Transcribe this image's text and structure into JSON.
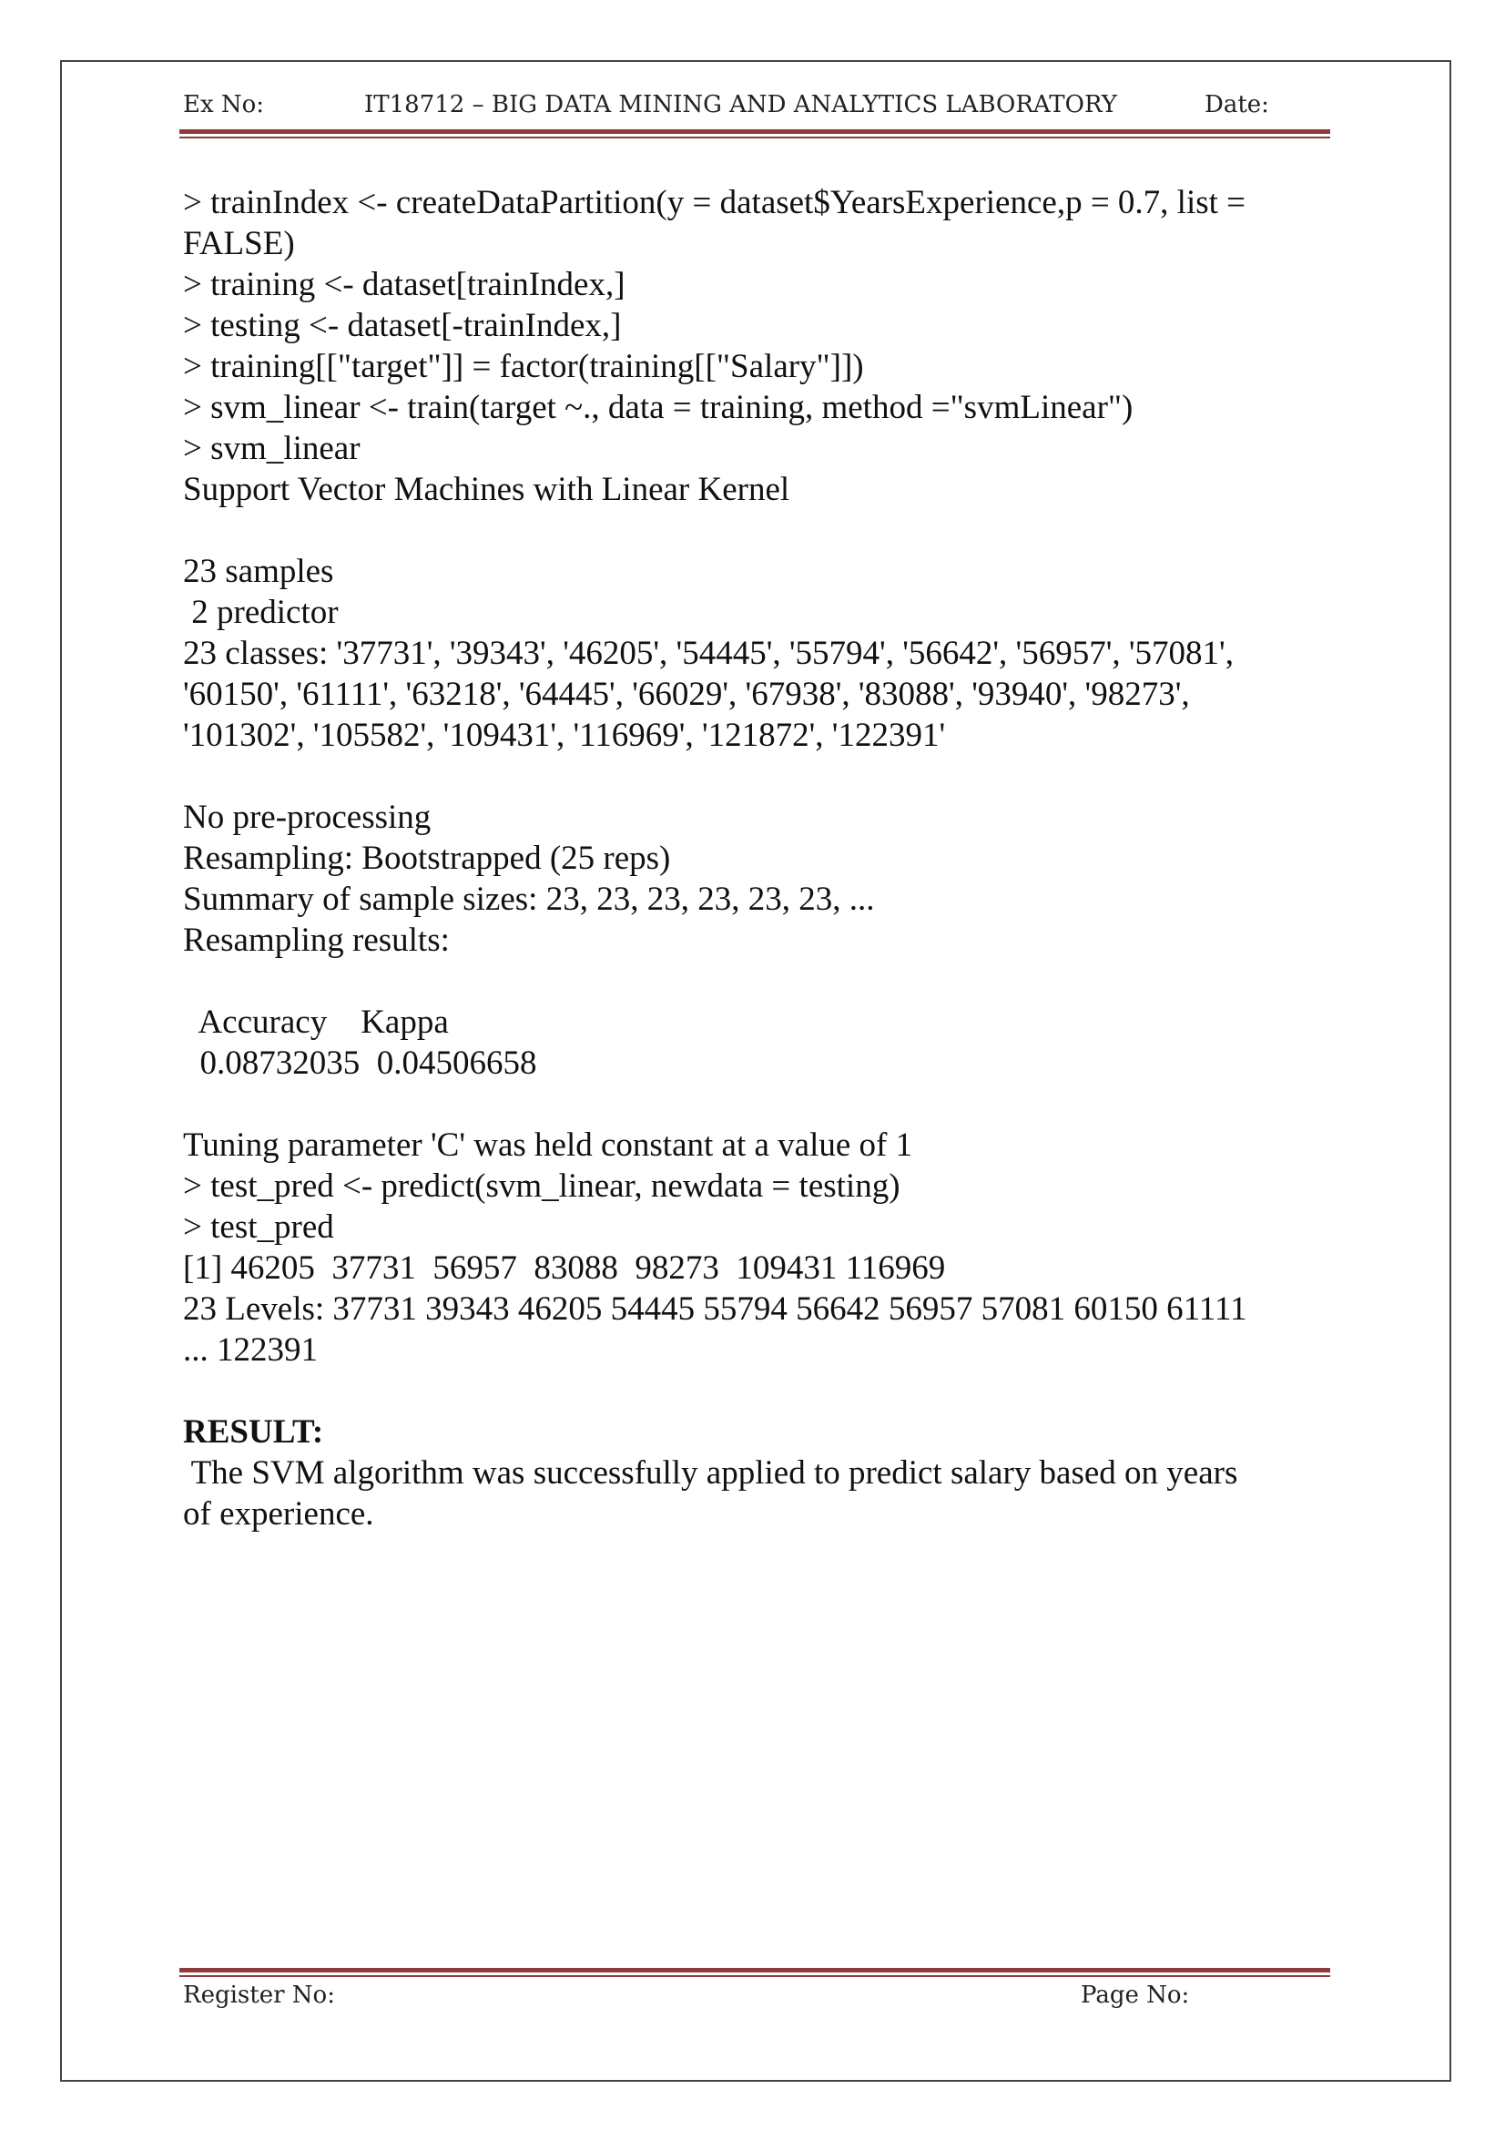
{
  "header": {
    "ex_no": "Ex No:",
    "course": "IT18712 – BIG DATA MINING AND ANALYTICS LABORATORY",
    "date": "Date:"
  },
  "code_lines": [
    "> trainIndex <- createDataPartition(y = dataset$YearsExperience,p = 0.7, list =",
    "FALSE)",
    "> training <- dataset[trainIndex,]",
    "> testing <- dataset[-trainIndex,]",
    "> training[[\"target\"]] = factor(training[[\"Salary\"]])",
    "> svm_linear <- train(target ~., data = training, method =\"svmLinear\")",
    "> svm_linear",
    "Support Vector Machines with Linear Kernel",
    "",
    "23 samples",
    " 2 predictor",
    "23 classes: '37731', '39343', '46205', '54445', '55794', '56642', '56957', '57081',",
    "'60150', '61111', '63218', '64445', '66029', '67938', '83088', '93940', '98273',",
    "'101302', '105582', '109431', '116969', '121872', '122391'",
    "",
    "No pre-processing",
    "Resampling: Bootstrapped (25 reps)",
    "Summary of sample sizes: 23, 23, 23, 23, 23, 23, ...",
    "Resampling results:",
    "",
    "  Accuracy    Kappa",
    "  0.08732035  0.04506658",
    "",
    "Tuning parameter 'C' was held constant at a value of 1",
    "> test_pred <- predict(svm_linear, newdata = testing)",
    "> test_pred",
    "[1] 46205  37731  56957  83088  98273  109431 116969",
    "23 Levels: 37731 39343 46205 54445 55794 56642 56957 57081 60150 61111",
    "... 122391",
    ""
  ],
  "result": {
    "heading": "RESULT:",
    "lines": [
      " The SVM algorithm was successfully applied to predict salary based on years",
      "of experience."
    ]
  },
  "footer": {
    "register_no": "Register No:",
    "page_no": "Page No:"
  }
}
